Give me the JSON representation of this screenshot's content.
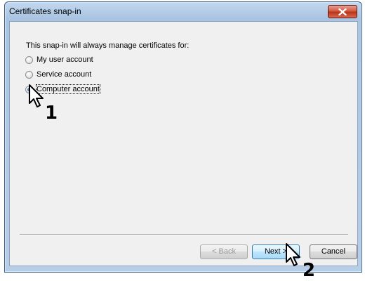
{
  "window": {
    "title": "Certificates snap-in"
  },
  "dialog": {
    "prompt": "This snap-in will always manage certificates for:",
    "options": [
      {
        "label": "My user account",
        "selected": false
      },
      {
        "label": "Service account",
        "selected": false
      },
      {
        "label": "Computer account",
        "selected": true
      }
    ]
  },
  "buttons": {
    "back": "< Back",
    "next": "Next >",
    "cancel": "Cancel"
  },
  "annotations": {
    "step1": "1",
    "step2": "2"
  }
}
